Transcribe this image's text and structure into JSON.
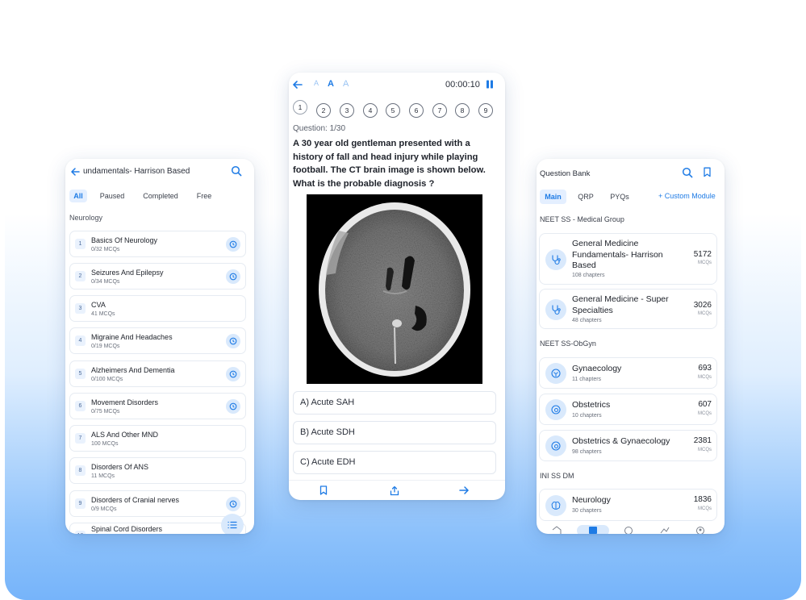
{
  "left": {
    "title": "undamentals- Harrison Based",
    "filters": [
      "All",
      "Paused",
      "Completed",
      "Free"
    ],
    "active_filter": "All",
    "section": "Neurology",
    "chapters": [
      {
        "num": "1",
        "name": "Basics Of Neurology",
        "progress": "0/32 MCQs",
        "clock": true
      },
      {
        "num": "2",
        "name": "Seizures And Epilepsy",
        "progress": "0/34 MCQs",
        "clock": true
      },
      {
        "num": "3",
        "name": "CVA",
        "progress": "41 MCQs",
        "clock": false
      },
      {
        "num": "4",
        "name": "Migraine And Headaches",
        "progress": "0/19 MCQs",
        "clock": true
      },
      {
        "num": "5",
        "name": "Alzheimers And Dementia",
        "progress": "0/100 MCQs",
        "clock": true
      },
      {
        "num": "6",
        "name": "Movement Disorders",
        "progress": "0/75 MCQs",
        "clock": true
      },
      {
        "num": "7",
        "name": "ALS And Other MND",
        "progress": "100 MCQs",
        "clock": false
      },
      {
        "num": "8",
        "name": "Disorders Of ANS",
        "progress": "11 MCQs",
        "clock": false
      },
      {
        "num": "9",
        "name": "Disorders of Cranial nerves",
        "progress": "0/9 MCQs",
        "clock": true
      },
      {
        "num": "10",
        "name": "Spinal Cord Disorders",
        "progress": "",
        "clock": false
      }
    ]
  },
  "center": {
    "font_sizes": [
      "A",
      "A",
      "A"
    ],
    "timer": "00:00:10",
    "question_numbers": [
      "1",
      "2",
      "3",
      "4",
      "5",
      "6",
      "7",
      "8",
      "9"
    ],
    "question_label": "Question: 1/30",
    "question_text": "A 30 year old gentleman presented with a history of fall and head injury while playing football. The CT brain image is shown below. What is the probable diagnosis ?",
    "options": [
      "A) Acute SAH",
      "B) Acute SDH",
      "C) Acute EDH"
    ]
  },
  "right": {
    "title": "Question Bank",
    "tabs": [
      "Main",
      "QRP",
      "PYQs"
    ],
    "active_tab": "Main",
    "custom_module": "+ Custom Module",
    "groups": [
      {
        "name": "NEET SS - Medical Group",
        "modules": [
          {
            "name": "General Medicine Fundamentals- Harrison Based",
            "chapters": "108 chapters",
            "count": "5172",
            "unit": "MCQs",
            "icon": "stethoscope-icon"
          },
          {
            "name": "General Medicine - Super Specialties",
            "chapters": "48 chapters",
            "count": "3026",
            "unit": "MCQs",
            "icon": "stethoscope-icon"
          }
        ]
      },
      {
        "name": "NEET SS-ObGyn",
        "modules": [
          {
            "name": "Gynaecology",
            "chapters": "11 chapters",
            "count": "693",
            "unit": "MCQs",
            "icon": "uterus-icon"
          },
          {
            "name": "Obstetrics",
            "chapters": "10 chapters",
            "count": "607",
            "unit": "MCQs",
            "icon": "pregnancy-icon"
          },
          {
            "name": "Obstetrics & Gynaecology",
            "chapters": "98 chapters",
            "count": "2381",
            "unit": "MCQs",
            "icon": "pregnancy-icon"
          }
        ]
      },
      {
        "name": "INI SS DM",
        "modules": [
          {
            "name": "Neurology",
            "chapters": "30 chapters",
            "count": "1836",
            "unit": "MCQs",
            "icon": "brain-icon"
          }
        ]
      }
    ]
  },
  "colors": {
    "accent": "#1e7be5",
    "chip_bg": "#e4efff",
    "icon_bg": "#d9e9fc"
  }
}
